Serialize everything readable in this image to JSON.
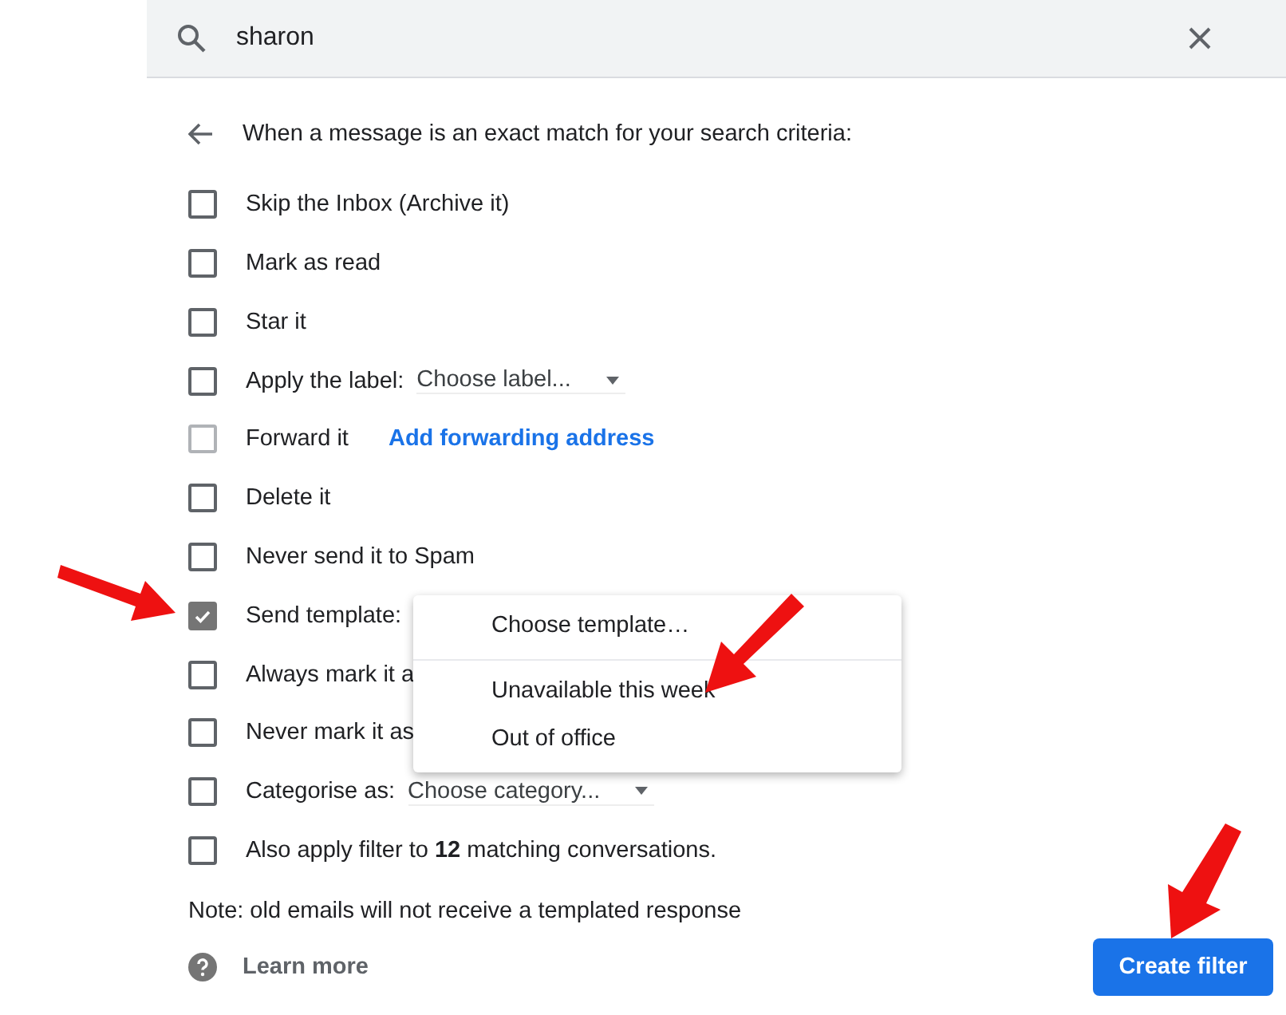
{
  "search": {
    "value": "sharon"
  },
  "heading": "When a message is an exact match for your search criteria:",
  "options": [
    {
      "kind": "plain",
      "label": "Skip the Inbox (Archive it)",
      "checked": false,
      "disabled": false
    },
    {
      "kind": "plain",
      "label": "Mark as read",
      "checked": false,
      "disabled": false
    },
    {
      "kind": "plain",
      "label": "Star it",
      "checked": false,
      "disabled": false
    },
    {
      "kind": "select",
      "label": "Apply the label:",
      "select": "Choose label...",
      "checked": false,
      "disabled": false
    },
    {
      "kind": "link",
      "label": "Forward it",
      "link": "Add forwarding address",
      "checked": false,
      "disabled": true
    },
    {
      "kind": "plain",
      "label": "Delete it",
      "checked": false,
      "disabled": false
    },
    {
      "kind": "plain",
      "label": "Never send it to Spam",
      "checked": false,
      "disabled": false
    },
    {
      "kind": "plain",
      "label": "Send template:",
      "checked": true,
      "disabled": false
    },
    {
      "kind": "plain",
      "label": "Always mark it a",
      "checked": false,
      "disabled": false
    },
    {
      "kind": "plain",
      "label": "Never mark it as",
      "checked": false,
      "disabled": false
    },
    {
      "kind": "select",
      "label": "Categorise as:",
      "select": "Choose category...",
      "checked": false,
      "disabled": false
    },
    {
      "kind": "rich",
      "label": "Also apply filter to **12** matching conversations.",
      "checked": false,
      "disabled": false
    }
  ],
  "template_menu": {
    "items": [
      {
        "label": "Choose template…",
        "divider_after": true
      },
      {
        "label": "Unavailable this week",
        "divider_after": false
      },
      {
        "label": "Out of office",
        "divider_after": false
      }
    ]
  },
  "note": "Note: old emails will not receive a templated response",
  "learn_more": "Learn more",
  "create_button": "Create filter"
}
